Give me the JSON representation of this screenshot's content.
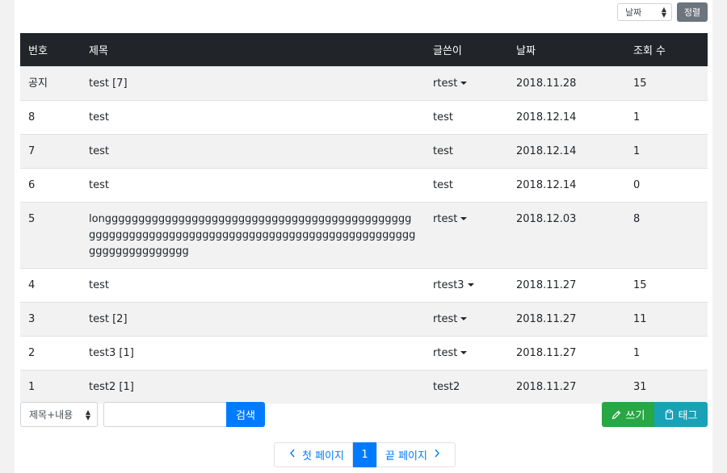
{
  "sort": {
    "selected": "날짜",
    "button_label": "정렬"
  },
  "table": {
    "headers": [
      "번호",
      "제목",
      "글쓴이",
      "날짜",
      "조회 수"
    ],
    "rows": [
      {
        "no": "공지",
        "title": "test [7]",
        "author": "rtest",
        "author_menu": true,
        "date": "2018.11.28",
        "views": "15"
      },
      {
        "no": "8",
        "title": "test",
        "author": "test",
        "author_menu": false,
        "date": "2018.12.14",
        "views": "1"
      },
      {
        "no": "7",
        "title": "test",
        "author": "test",
        "author_menu": false,
        "date": "2018.12.14",
        "views": "1"
      },
      {
        "no": "6",
        "title": "test",
        "author": "test",
        "author_menu": false,
        "date": "2018.12.14",
        "views": "0"
      },
      {
        "no": "5",
        "title": "longggggggggggggggggggggggggggggggggggggggggggggggggggggggggggggggggggggggggggggggggggggggggggggggggggggggggggggg",
        "author": "rtest",
        "author_menu": true,
        "date": "2018.12.03",
        "views": "8"
      },
      {
        "no": "4",
        "title": "test",
        "author": "rtest3",
        "author_menu": true,
        "date": "2018.11.27",
        "views": "15"
      },
      {
        "no": "3",
        "title": "test [2]",
        "author": "rtest",
        "author_menu": true,
        "date": "2018.11.27",
        "views": "11"
      },
      {
        "no": "2",
        "title": "test3 [1]",
        "author": "rtest",
        "author_menu": true,
        "date": "2018.11.27",
        "views": "1"
      },
      {
        "no": "1",
        "title": "test2 [1]",
        "author": "test2",
        "author_menu": false,
        "date": "2018.11.27",
        "views": "31"
      }
    ]
  },
  "search": {
    "field_selected": "제목+내용",
    "query": "",
    "button_label": "검색"
  },
  "actions": {
    "write_label": "쓰기",
    "tag_label": "태그"
  },
  "pagination": {
    "first_label": "첫 페이지",
    "current": "1",
    "last_label": "끝 페이지"
  },
  "colors": {
    "header_bg": "#212529",
    "primary": "#007bff",
    "success": "#28a745",
    "info": "#17a2b8",
    "secondary": "#6c757d"
  },
  "icons": [
    "up-down-caret-icon",
    "dropdown-caret-icon",
    "pencil-icon",
    "clipboard-icon",
    "chevron-left-icon",
    "chevron-right-icon"
  ]
}
